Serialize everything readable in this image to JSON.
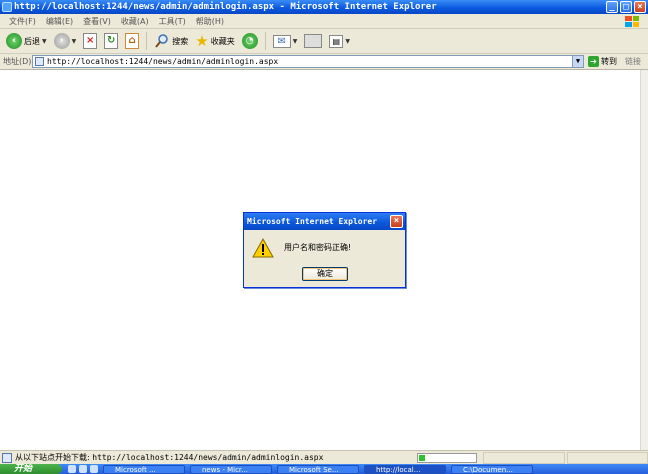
{
  "window": {
    "title": "http://localhost:1244/news/admin/adminlogin.aspx - Microsoft Internet Explorer",
    "min_glyph": "_",
    "max_glyph": "□",
    "close_glyph": "×"
  },
  "menu": {
    "items": [
      "文件(F)",
      "编辑(E)",
      "查看(V)",
      "收藏(A)",
      "工具(T)",
      "帮助(H)"
    ]
  },
  "toolbar": {
    "back_label": "后退",
    "search_label": "搜索",
    "favorites_label": "收藏夹"
  },
  "address": {
    "label": "地址(D)",
    "url": "http://localhost:1244/news/admin/adminlogin.aspx",
    "go_label": "转到",
    "links_label": "链接"
  },
  "dialog": {
    "title": "Microsoft Internet Explorer",
    "message": "用户名和密码正确!",
    "ok_label": "确定"
  },
  "status": {
    "text_prefix": "从以下站点开始下载:",
    "url": "http://localhost:1244/news/admin/adminlogin.aspx",
    "progress": 0.1
  },
  "taskbar": {
    "start_label": "开始",
    "tasks": [
      "Microsoft ...",
      "news - Micr...",
      "Microsoft Se...",
      "http://local...",
      "C:\\Documen..."
    ]
  },
  "colors": {
    "title_blue": "#0a58e0",
    "chrome": "#ece9d8",
    "dialog_border": "#0831d9"
  }
}
